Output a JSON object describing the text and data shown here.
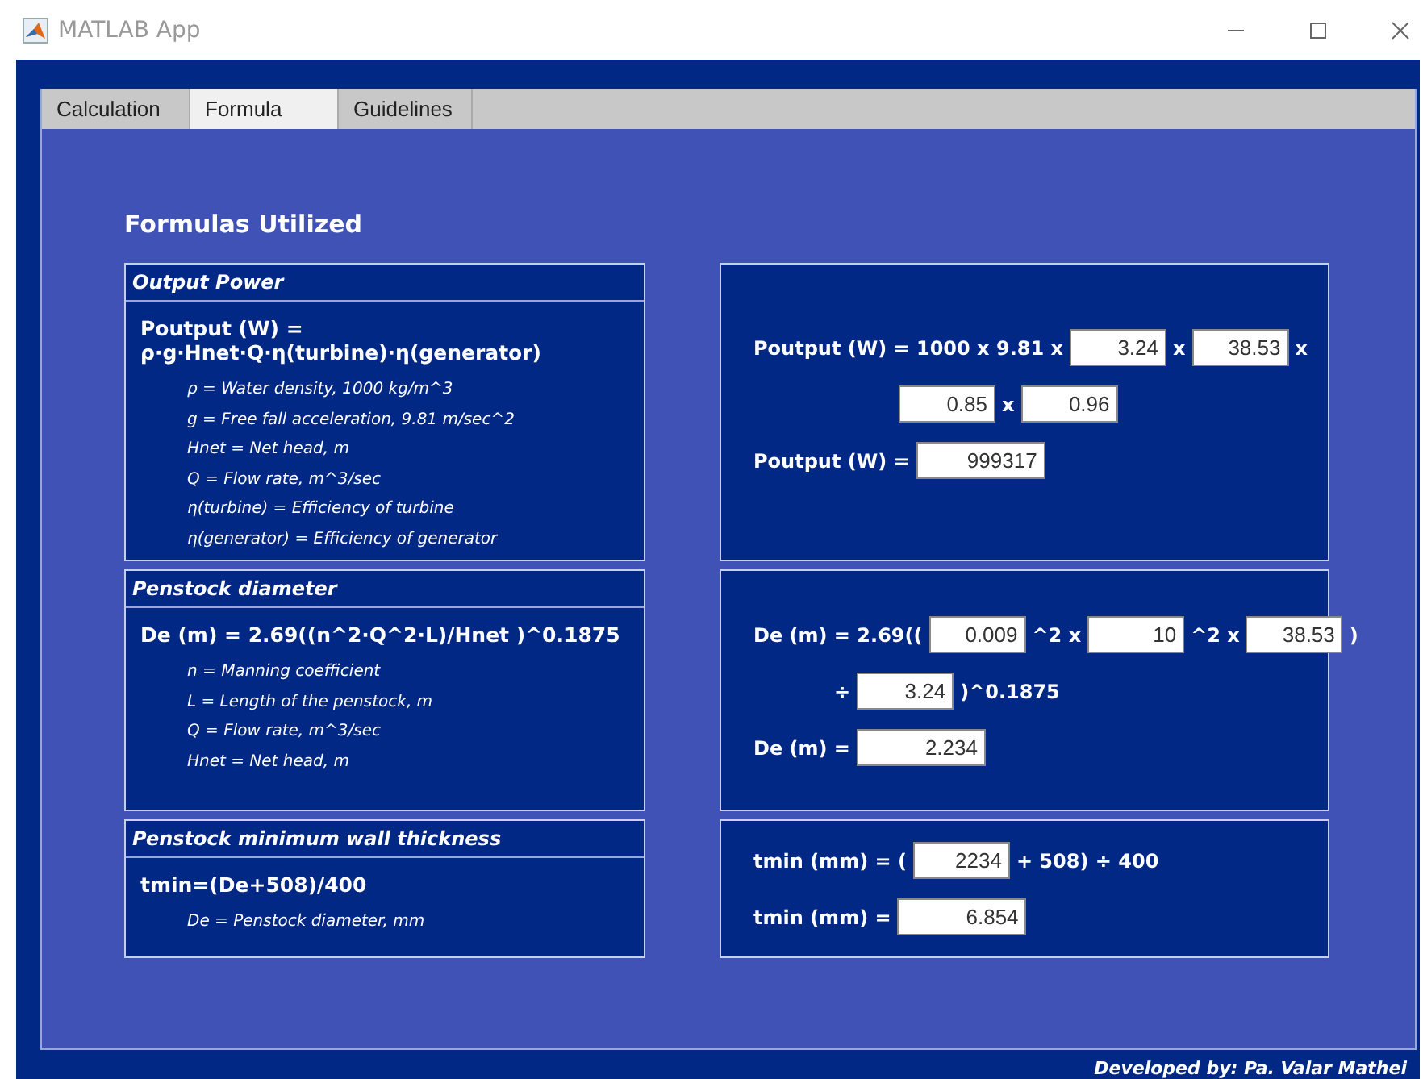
{
  "window": {
    "title": "MATLAB App"
  },
  "tabs": [
    {
      "label": "Calculation",
      "selected": false
    },
    {
      "label": "Formula",
      "selected": true
    },
    {
      "label": "Guidelines",
      "selected": false
    }
  ],
  "heading": "Formulas Utilized",
  "formula_panels": [
    {
      "title": "Output Power",
      "formula": "Poutput (W) = ρ·g·Hnet·Q·η(turbine)·η(generator)",
      "definitions": [
        "ρ = Water density, 1000 kg/m^3",
        "g = Free fall acceleration, 9.81 m/sec^2",
        "Hnet = Net head, m",
        "Q = Flow rate, m^3/sec",
        "η(turbine) = Efficiency of turbine",
        "η(generator) = Efficiency of generator"
      ]
    },
    {
      "title": "Penstock diameter",
      "formula": "De (m) = 2.69((n^2·Q^2·L)/Hnet )^0.1875",
      "definitions": [
        "n = Manning coefficient",
        "L = Length of the penstock, m",
        "Q = Flow rate, m^3/sec",
        "Hnet = Net head, m"
      ]
    },
    {
      "title": "Penstock minimum wall thickness",
      "formula": "tmin=(De+508)/400",
      "definitions": [
        "De = Penstock diameter, mm"
      ]
    }
  ],
  "calculation_panels": [
    {
      "rows": [
        {
          "kind": "equation",
          "items": [
            {
              "kind": "text",
              "text": "Poutput (W) = 1000 x 9.81 x"
            },
            {
              "kind": "field",
              "value": "3.24"
            },
            {
              "kind": "text",
              "text": "x"
            },
            {
              "kind": "field",
              "value": "38.53"
            },
            {
              "kind": "text",
              "text": "x"
            }
          ]
        },
        {
          "kind": "continuation",
          "items": [
            {
              "kind": "field",
              "value": "0.85"
            },
            {
              "kind": "text",
              "text": "x"
            },
            {
              "kind": "field",
              "value": "0.96"
            }
          ]
        },
        {
          "kind": "result",
          "items": [
            {
              "kind": "text",
              "text": "Poutput (W) ="
            },
            {
              "kind": "field",
              "value": "999317"
            }
          ]
        }
      ]
    },
    {
      "rows": [
        {
          "kind": "equation",
          "items": [
            {
              "kind": "text",
              "text": "De (m) = 2.69(("
            },
            {
              "kind": "field",
              "value": "0.009"
            },
            {
              "kind": "text",
              "text": "^2 x"
            },
            {
              "kind": "field",
              "value": "10"
            },
            {
              "kind": "text",
              "text": "^2 x"
            },
            {
              "kind": "field",
              "value": "38.53"
            },
            {
              "kind": "text",
              "text": ")"
            }
          ]
        },
        {
          "kind": "continuation",
          "items": [
            {
              "kind": "text",
              "text": "÷"
            },
            {
              "kind": "field",
              "value": "3.24"
            },
            {
              "kind": "text",
              "text": ")^0.1875"
            }
          ]
        },
        {
          "kind": "result",
          "items": [
            {
              "kind": "text",
              "text": "De (m) ="
            },
            {
              "kind": "field",
              "value": "2.234"
            }
          ]
        }
      ]
    },
    {
      "rows": [
        {
          "kind": "equation",
          "items": [
            {
              "kind": "text",
              "text": "tmin (mm) = ("
            },
            {
              "kind": "field",
              "value": "2234"
            },
            {
              "kind": "text",
              "text": "+ 508) ÷ 400"
            }
          ]
        },
        {
          "kind": "result",
          "items": [
            {
              "kind": "text",
              "text": "tmin (mm) ="
            },
            {
              "kind": "field",
              "value": "6.854"
            }
          ]
        }
      ]
    }
  ],
  "footer": "Developed by: Pa. Valar Mathei"
}
